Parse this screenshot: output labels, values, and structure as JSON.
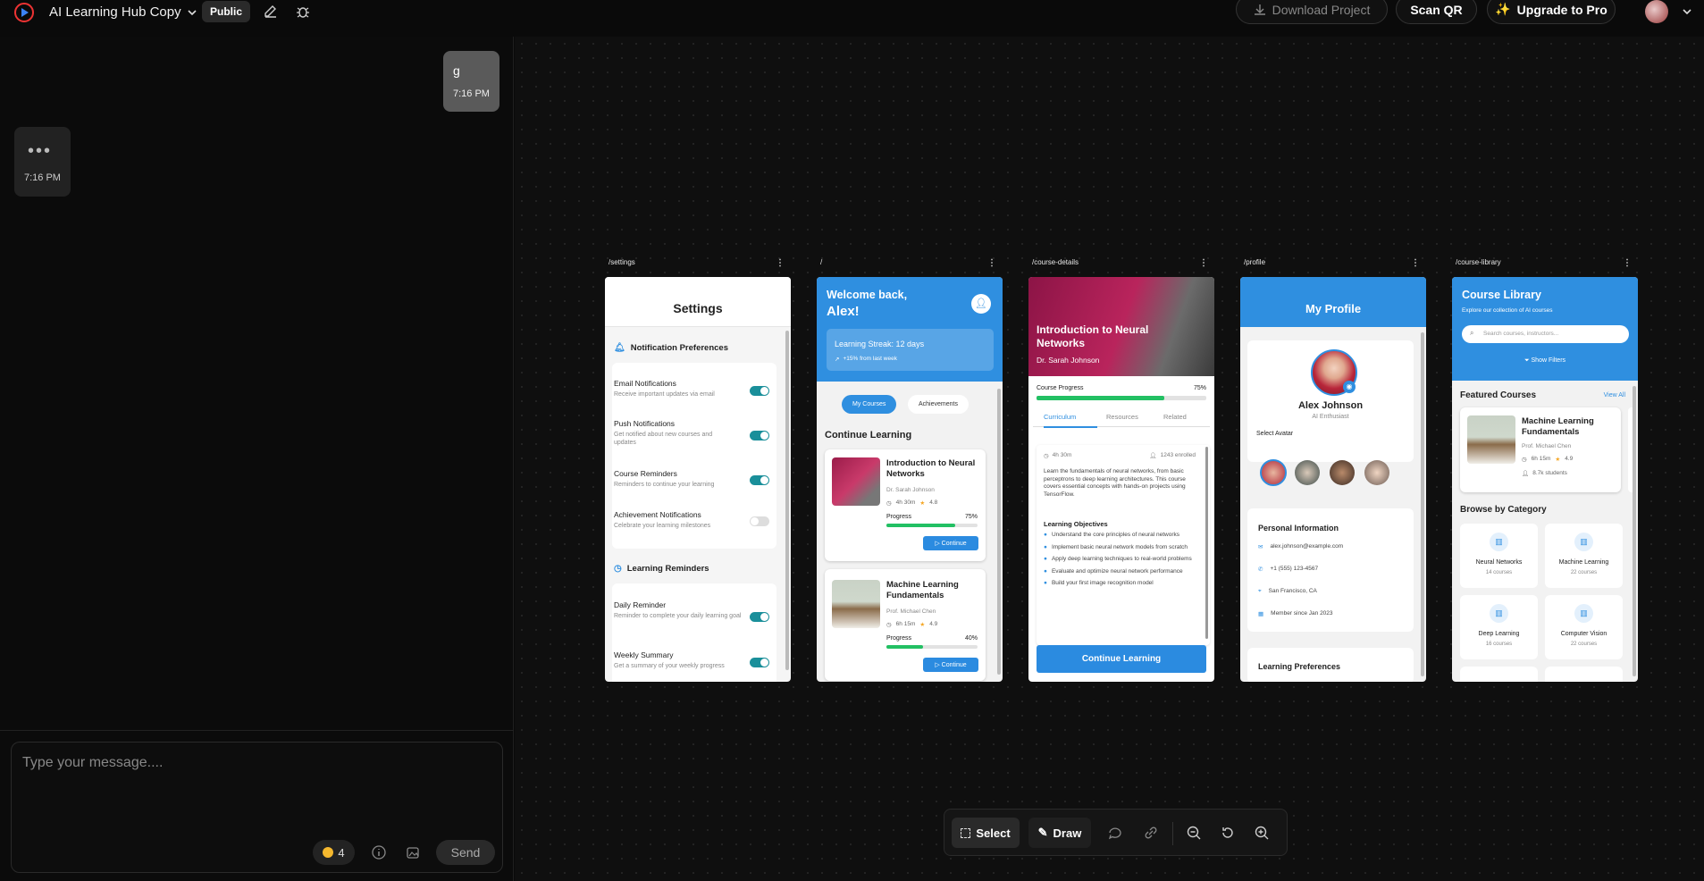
{
  "app": {
    "name": "AI Learning Hub Copy",
    "visibility": "Public"
  },
  "topbar": {
    "download": "Download Project",
    "scan_qr": "Scan QR",
    "upgrade": "Upgrade to Pro"
  },
  "chat": {
    "user_message": {
      "text": "g",
      "time": "7:16 PM"
    },
    "bot_message": {
      "text": "•••",
      "time": "7:16 PM"
    },
    "input_placeholder": "Type your message....",
    "credits": "4",
    "send": "Send"
  },
  "toolbar": {
    "select": "Select",
    "draw": "Draw"
  },
  "frames": {
    "settings": {
      "route": "/settings",
      "title": "Settings",
      "section1": "Notification Preferences",
      "items1": [
        {
          "title": "Email Notifications",
          "sub": "Receive important updates via email",
          "on": true
        },
        {
          "title": "Push Notifications",
          "sub": "Get notified about new courses and updates",
          "on": true
        },
        {
          "title": "Course Reminders",
          "sub": "Reminders to continue your learning",
          "on": true
        },
        {
          "title": "Achievement Notifications",
          "sub": "Celebrate your learning milestones",
          "on": false
        }
      ],
      "section2": "Learning Reminders",
      "items2": [
        {
          "title": "Daily Reminder",
          "sub": "Reminder to complete your daily learning goal",
          "on": true
        },
        {
          "title": "Weekly Summary",
          "sub": "Get a summary of your weekly progress",
          "on": true
        }
      ]
    },
    "home": {
      "route": "/",
      "greeting": "Welcome back,",
      "name": "Alex!",
      "streak": "Learning Streak: 12 days",
      "streak_sub": "+15% from last week",
      "tab_active": "My Courses",
      "tab_other": "Achievements",
      "section": "Continue Learning",
      "courses": [
        {
          "title": "Introduction to Neural Networks",
          "author": "Dr. Sarah Johnson",
          "duration": "4h 30m",
          "rating": "4.8",
          "progress_label": "Progress",
          "progress": "75%",
          "progress_value": 0.75,
          "cta": "Continue"
        },
        {
          "title": "Machine Learning Fundamentals",
          "author": "Prof. Michael Chen",
          "duration": "6h 15m",
          "rating": "4.9",
          "progress_label": "Progress",
          "progress": "40%",
          "progress_value": 0.4,
          "cta": "Continue"
        }
      ]
    },
    "details": {
      "route": "/course-details",
      "title": "Introduction to Neural Networks",
      "author": "Dr. Sarah Johnson",
      "progress_label": "Course Progress",
      "progress": "75%",
      "progress_value": 0.75,
      "tabs": [
        "Curriculum",
        "Resources",
        "Related"
      ],
      "duration": "4h 30m",
      "enrolled": "1243 enrolled",
      "description": "Learn the fundamentals of neural networks, from basic perceptrons to deep learning architectures. This course covers essential concepts with hands-on projects using TensorFlow.",
      "objectives_title": "Learning Objectives",
      "objectives": [
        "Understand the core principles of neural networks",
        "Implement basic neural network models from scratch",
        "Apply deep learning techniques to real-world problems",
        "Evaluate and optimize neural network performance",
        "Build your first image recognition model"
      ],
      "cta": "Continue Learning"
    },
    "profile": {
      "route": "/profile",
      "title": "My Profile",
      "name": "Alex Johnson",
      "role": "AI Enthusiast",
      "avatar_label": "Select Avatar",
      "personal_title": "Personal Information",
      "email": "alex.johnson@example.com",
      "phone": "+1 (555) 123-4567",
      "location": "San Francisco, CA",
      "member": "Member since Jan 2023",
      "prefs_title": "Learning Preferences"
    },
    "library": {
      "route": "/course-library",
      "title": "Course Library",
      "subtitle": "Explore our collection of AI courses",
      "search_placeholder": "Search courses, instructors...",
      "filters": "Show Filters",
      "featured": "Featured Courses",
      "view_all": "View All",
      "featured_course": {
        "title": "Machine Learning Fundamentals",
        "author": "Prof. Michael Chen",
        "duration": "6h 15m",
        "rating": "4.9",
        "students": "8.7k students"
      },
      "browse": "Browse by Category",
      "categories": [
        {
          "name": "Neural Networks",
          "count": "14 courses"
        },
        {
          "name": "Machine Learning",
          "count": "22 courses"
        },
        {
          "name": "Deep Learning",
          "count": "16 courses"
        },
        {
          "name": "Computer Vision",
          "count": "22 courses"
        }
      ]
    }
  }
}
